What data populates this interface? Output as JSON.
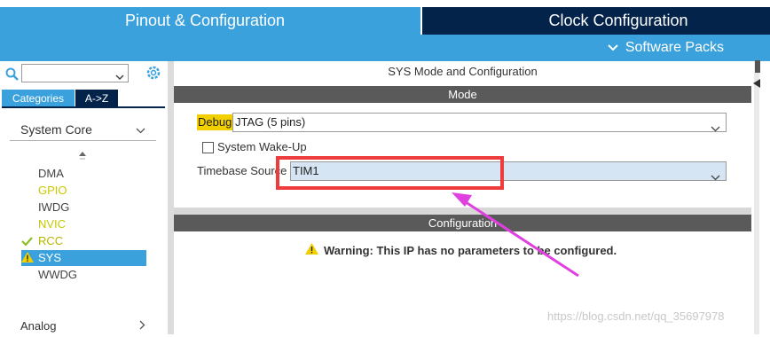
{
  "header": {
    "tab_pinout": "Pinout & Configuration",
    "tab_clock": "Clock Configuration",
    "software_packs": "Software Packs"
  },
  "sidebar": {
    "tabs": [
      "Categories",
      "A->Z"
    ],
    "section": "System Core",
    "items": [
      {
        "label": "DMA",
        "state": "normal"
      },
      {
        "label": "GPIO",
        "state": "yellow"
      },
      {
        "label": "IWDG",
        "state": "normal"
      },
      {
        "label": "NVIC",
        "state": "yellow"
      },
      {
        "label": "RCC",
        "state": "checked"
      },
      {
        "label": "SYS",
        "state": "selected-warning"
      },
      {
        "label": "WWDG",
        "state": "normal"
      }
    ],
    "section2": "Analog"
  },
  "main": {
    "title": "SYS Mode and Configuration",
    "mode_header": "Mode",
    "debug_label": "Debug",
    "debug_value": "JTAG (5 pins)",
    "wakeup_label": "System Wake-Up",
    "timebase_label": "Timebase Source",
    "timebase_value": "TIM1",
    "config_header": "Configuration",
    "warning_text": "Warning: This IP has no parameters to be configured."
  },
  "watermark": "https://blog.csdn.net/qq_35697978",
  "colors": {
    "accent_blue": "#3ba1dc",
    "dark_navy": "#03234b",
    "highlight_red": "#ee3b3b",
    "annotation_magenta": "#e040e0"
  }
}
